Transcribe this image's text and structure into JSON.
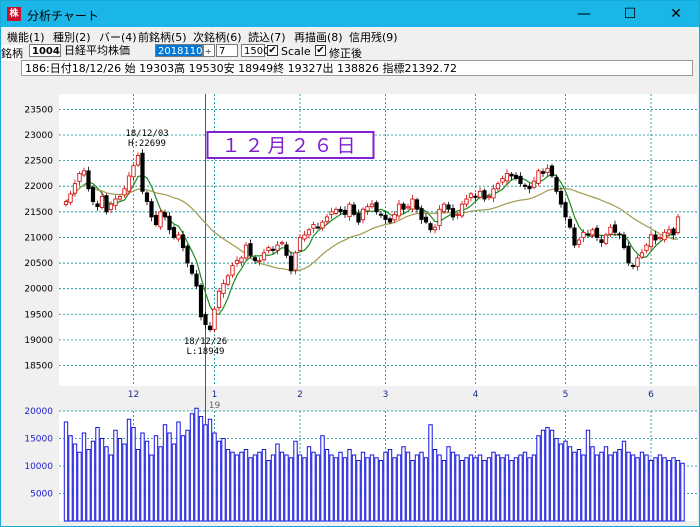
{
  "window": {
    "title": "分析チャート",
    "app_icon": "chart-app-icon",
    "minimize_glyph": "—",
    "maximize_glyph": "☐",
    "close_glyph": "✕"
  },
  "menu": [
    "機能(1)",
    "種別(2)",
    "バー(4)",
    "前銘柄(5)",
    "次銘柄(6)",
    "読込(7)",
    "再描画(8)",
    "信用残(9)"
  ],
  "toolbar": {
    "label": "銘柄",
    "code": "1004",
    "name": "日経平均株価",
    "date": "20181102",
    "period": "7",
    "count": "1500",
    "scale_checked": true,
    "scale_label": "Scale",
    "adjusted_checked": true,
    "adjusted_label": "修正後"
  },
  "info_line": "186:日付18/12/26 始 19303高 19530安 18949終 19327出 138826 指標21392.72",
  "chart_data": {
    "type": "candlestick",
    "price_axis": {
      "ylim": [
        18100,
        23800
      ],
      "ticks": [
        23500,
        23000,
        22500,
        22000,
        21500,
        21000,
        20500,
        20000,
        19500,
        19000,
        18500
      ]
    },
    "volume_axis": {
      "ylim": [
        0,
        20000
      ],
      "ticks": [
        20000,
        15000,
        10000,
        5000
      ]
    },
    "x_labels": [
      {
        "label": "12",
        "index": 15
      },
      {
        "label": "1",
        "index": 33
      },
      {
        "label": "2",
        "index": 52
      },
      {
        "label": "3",
        "index": 71
      },
      {
        "label": "4",
        "index": 91
      },
      {
        "label": "5",
        "index": 111
      },
      {
        "label": "6",
        "index": 130
      }
    ],
    "year_label": {
      "label": "19",
      "index": 33
    },
    "grid": true,
    "highlight": {
      "index": 31,
      "label": "１２月２６日"
    },
    "annotations": [
      {
        "index": 18,
        "lines": [
          "18/12/03",
          "H:22699"
        ],
        "position": "above"
      },
      {
        "index": 31,
        "lines": [
          "18/12/26",
          "L:18949"
        ],
        "position": "below"
      }
    ],
    "close": [
      21700,
      21850,
      22050,
      22250,
      22300,
      21950,
      21700,
      21600,
      21800,
      21500,
      21650,
      21750,
      21800,
      21950,
      22200,
      22400,
      22600,
      21900,
      21700,
      21400,
      21250,
      21500,
      21400,
      21150,
      21000,
      21050,
      20800,
      20500,
      20300,
      20050,
      19450,
      19300,
      19200,
      19600,
      19950,
      20100,
      20250,
      20450,
      20550,
      20600,
      20850,
      20650,
      20550,
      20550,
      20700,
      20800,
      20750,
      20850,
      20900,
      20650,
      20350,
      20700,
      21000,
      21050,
      21150,
      21250,
      21200,
      21300,
      21400,
      21500,
      21550,
      21500,
      21450,
      21650,
      21450,
      21300,
      21550,
      21600,
      21650,
      21500,
      21450,
      21350,
      21300,
      21450,
      21650,
      21550,
      21600,
      21750,
      21550,
      21350,
      21300,
      21150,
      21200,
      21550,
      21650,
      21550,
      21400,
      21450,
      21650,
      21750,
      21850,
      21800,
      21900,
      21750,
      21800,
      21950,
      22050,
      22150,
      22250,
      22200,
      22150,
      22050,
      22000,
      21950,
      22100,
      22300,
      22250,
      22350,
      22200,
      21900,
      21650,
      21400,
      21200,
      20850,
      20950,
      21100,
      21050,
      21150,
      21000,
      20900,
      21050,
      21200,
      21100,
      21050,
      20800,
      20500,
      20450,
      20600,
      20700,
      20850,
      21050,
      20950,
      21000,
      21100,
      21150,
      21050,
      21400
    ]
  },
  "volume": [
    18000,
    15500,
    14000,
    12500,
    16000,
    13000,
    14500,
    17000,
    15000,
    13500,
    12000,
    16500,
    15000,
    14000,
    18500,
    17000,
    13000,
    16000,
    14500,
    12000,
    15500,
    13500,
    17500,
    16000,
    14000,
    18000,
    15500,
    16500,
    19500,
    20500,
    19000,
    17500,
    18500,
    16000,
    14500,
    15000,
    13000,
    12500,
    12000,
    12500,
    13000,
    11500,
    12000,
    12500,
    13000,
    11000,
    12000,
    14000,
    12500,
    12000,
    11500,
    14500,
    12000,
    11500,
    13500,
    12500,
    12000,
    15500,
    13000,
    12000,
    11500,
    12500,
    11500,
    13000,
    12000,
    11000,
    12500,
    11500,
    12000,
    11500,
    11000,
    12500,
    13000,
    11500,
    12000,
    13500,
    12500,
    11000,
    12000,
    12500,
    11500,
    17500,
    13000,
    12000,
    11000,
    13500,
    12500,
    12000,
    11000,
    11500,
    12000,
    11500,
    12000,
    11000,
    11500,
    12500,
    12000,
    11500,
    12000,
    11000,
    11500,
    12000,
    12500,
    11500,
    12000,
    15500,
    16500,
    17000,
    16500,
    15000,
    14000,
    14500,
    13500,
    12500,
    13000,
    12000,
    16500,
    13500,
    12000,
    12500,
    13500,
    12000,
    12500,
    13000,
    14500,
    12500,
    12000,
    11500,
    12500,
    12000,
    11000,
    11500,
    12000,
    11500,
    11000,
    11500,
    11000,
    10500
  ]
}
